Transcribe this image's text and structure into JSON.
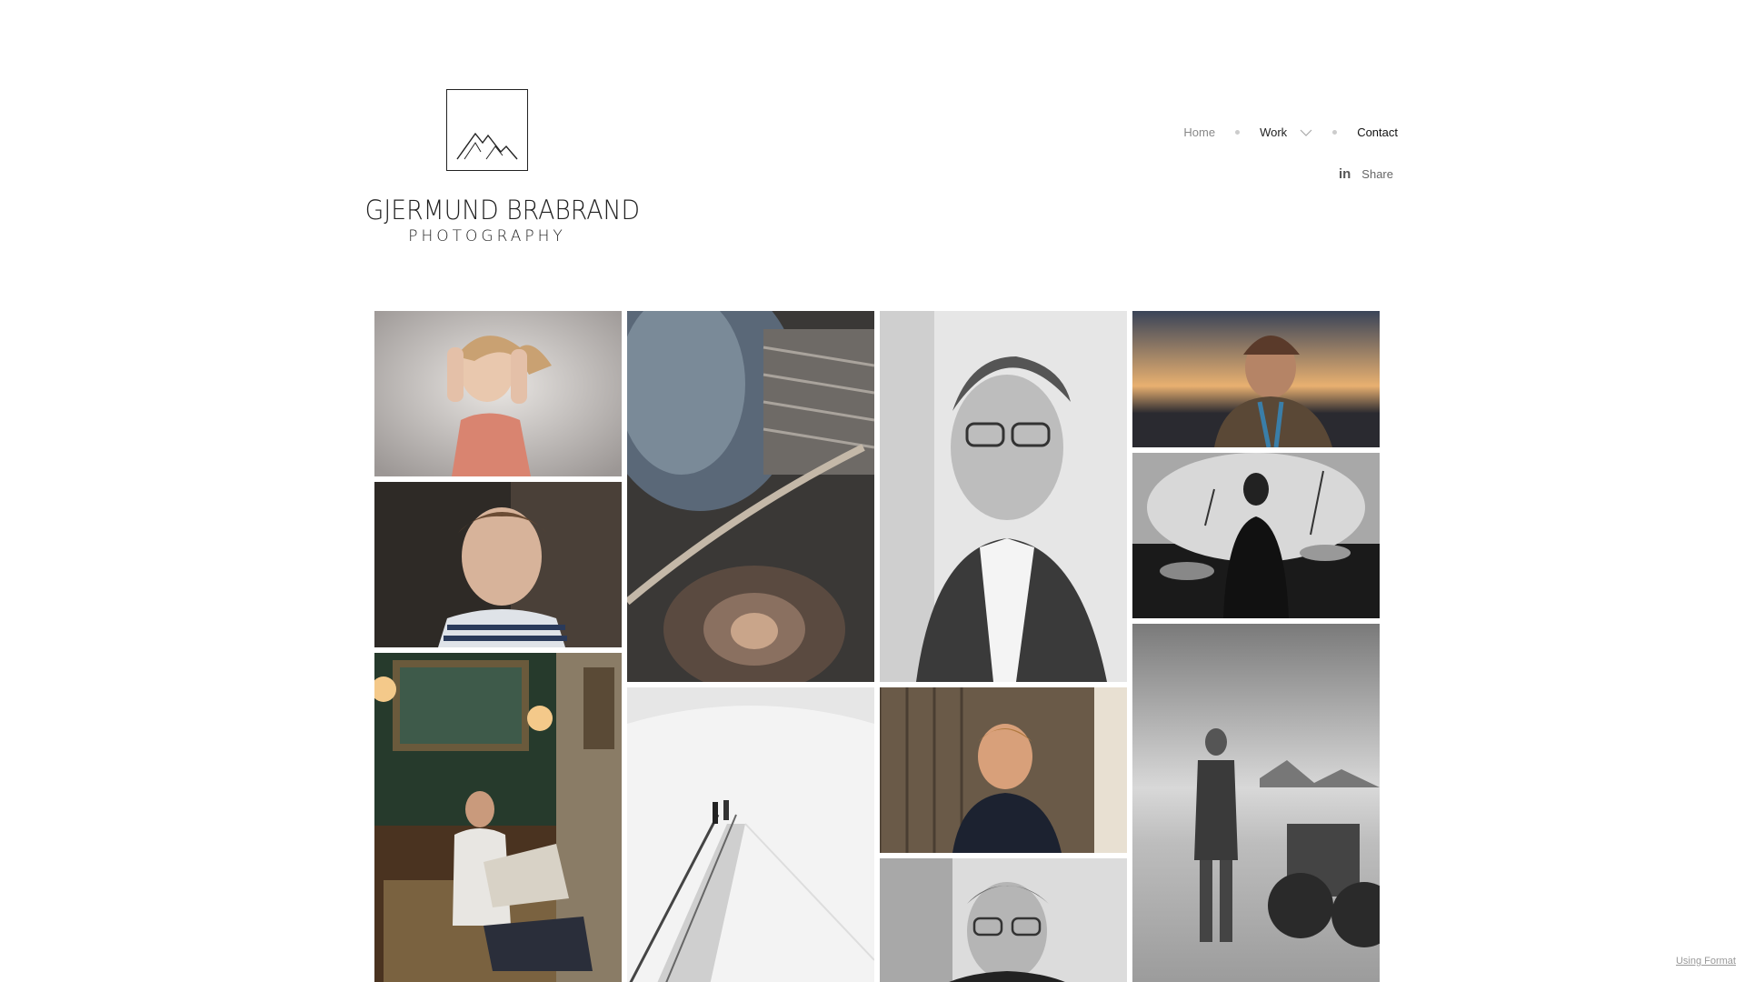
{
  "logo": {
    "name": "GJERMUND BRABRAND",
    "subtitle": "PHOTOGRAPHY"
  },
  "nav": {
    "home": "Home",
    "work": "Work",
    "contact": "Contact",
    "share": "Share",
    "linkedin_icon": "in"
  },
  "gallery": {
    "photos": [
      {
        "name": "girl-portrait-photo"
      },
      {
        "name": "rusty-machinery-photo"
      },
      {
        "name": "older-man-portrait-photo"
      },
      {
        "name": "man-sunset-photo"
      },
      {
        "name": "boy-portrait-photo"
      },
      {
        "name": "concert-stage-photo"
      },
      {
        "name": "man-reading-newspaper-photo"
      },
      {
        "name": "escalator-photo"
      },
      {
        "name": "man-barn-door-photo"
      },
      {
        "name": "man-beach-tractor-photo"
      },
      {
        "name": "man-glasses-portrait-photo"
      }
    ]
  },
  "footer": {
    "format_link": "Using Format"
  }
}
